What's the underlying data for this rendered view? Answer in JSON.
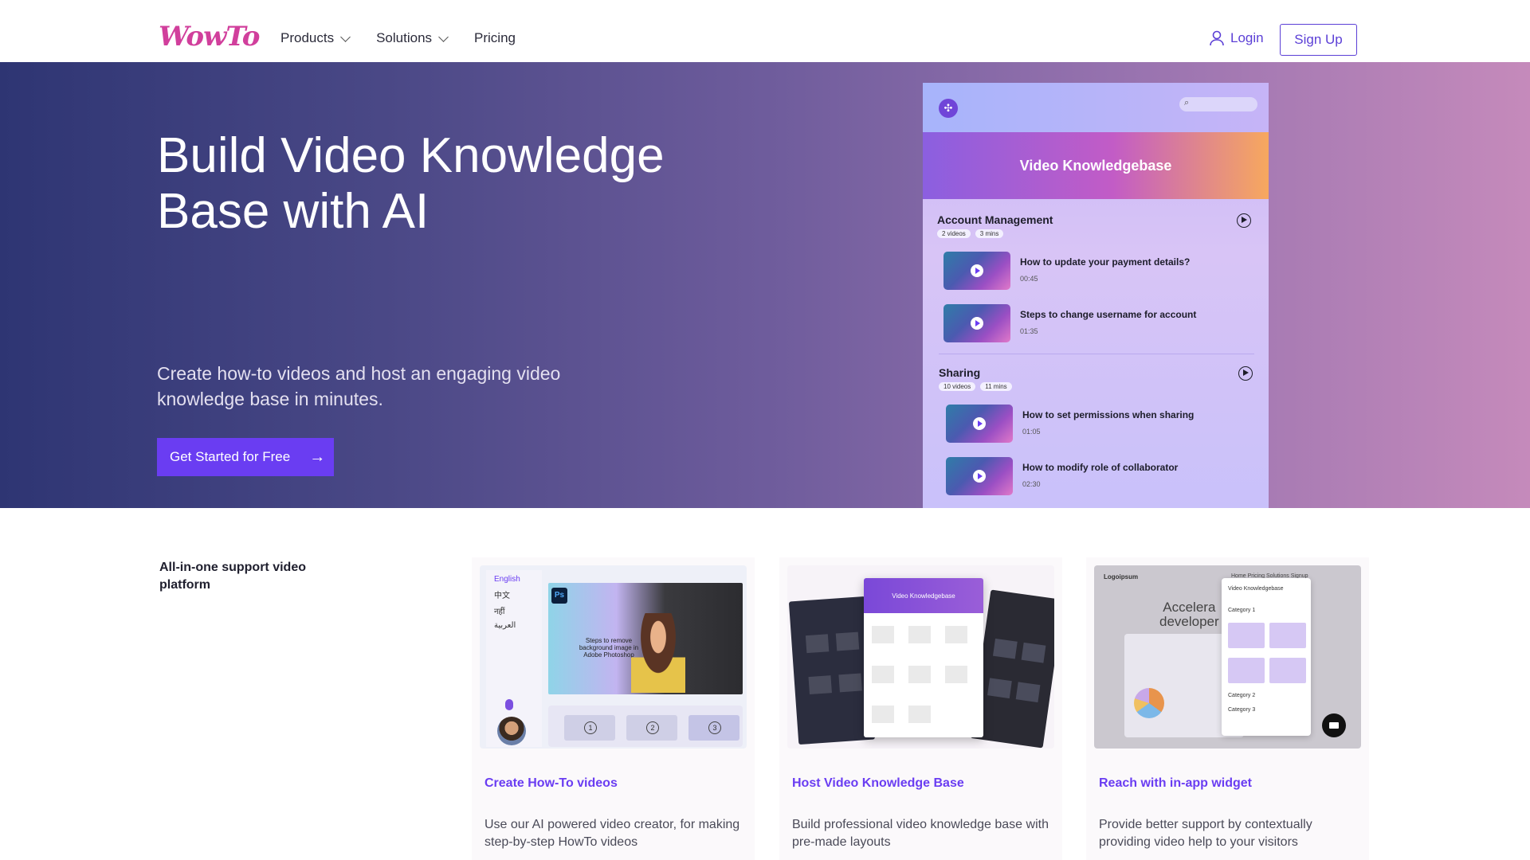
{
  "stray_char": "]",
  "header": {
    "logo": "WowTo",
    "nav": [
      {
        "label": "Products",
        "has_dropdown": true
      },
      {
        "label": "Solutions",
        "has_dropdown": true
      },
      {
        "label": "Pricing",
        "has_dropdown": false
      }
    ],
    "login_label": "Login",
    "signup_label": "Sign Up"
  },
  "hero": {
    "title_line1": "Build Video Knowledge",
    "title_line2": "Base with AI",
    "subtitle": "Create how-to videos and host an engaging video knowledge base in minutes.",
    "cta_label": "Get Started for Free",
    "cta_arrow": "→"
  },
  "mockup": {
    "banner": "Video Knowledgebase",
    "sections": [
      {
        "title": "Account Management",
        "videos_badge": "2 videos",
        "mins_badge": "3 mins",
        "items": [
          {
            "title": "How to update your payment details?",
            "time": "00:45"
          },
          {
            "title": "Steps to change username for account",
            "time": "01:35"
          }
        ]
      },
      {
        "title": "Sharing",
        "videos_badge": "10 videos",
        "mins_badge": "11 mins",
        "items": [
          {
            "title": "How to set permissions when sharing",
            "time": "01:05"
          },
          {
            "title": "How to modify role of collaborator",
            "time": "02:30"
          }
        ]
      }
    ]
  },
  "features": {
    "label": "All-in-one support video platform",
    "cards": [
      {
        "title": "Create How-To videos",
        "desc": "Use our AI powered video creator, for making step-by-step HowTo videos",
        "languages": [
          "English",
          "中文",
          "नहीं",
          "العربية"
        ],
        "ps_badge": "Ps",
        "ps_text": "Steps to remove background image in Adobe Photoshop",
        "steps": [
          "1",
          "2",
          "3"
        ]
      },
      {
        "title": "Host Video Knowledge Base",
        "desc": "Build professional video knowledge base with pre-made layouts",
        "mini_title": "Video Knowledgebase"
      },
      {
        "title": "Reach with in-app widget",
        "desc": "Provide better support by contextually providing video help to your visitors",
        "site_logo": "Logoipsum",
        "site_nav": "Home   Pricing   Solutions   Signup",
        "site_text_line1": "Accelera",
        "site_text_line2": "developer",
        "panel_title": "Video Knowledgebase",
        "category1": "Category 1",
        "category2": "Category 2",
        "category3": "Category 3"
      }
    ]
  }
}
